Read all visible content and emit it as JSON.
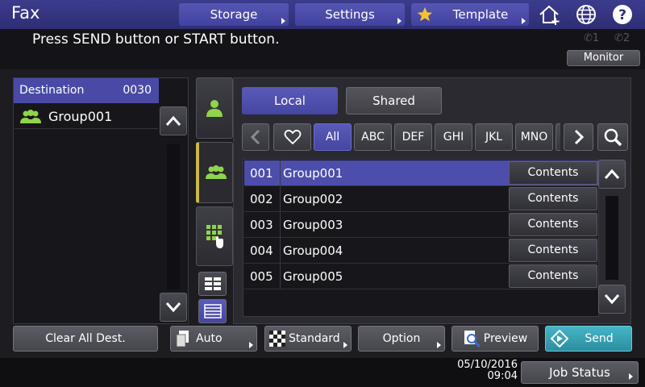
{
  "header": {
    "title": "Fax",
    "storage_label": "Storage",
    "settings_label": "Settings",
    "template_label": "Template",
    "icons": [
      "home-icon",
      "globe-icon",
      "help-icon"
    ]
  },
  "message": {
    "text": "Press SEND button or START button.",
    "line1": "1",
    "line2": "2",
    "monitor_label": "Monitor"
  },
  "destination": {
    "label": "Destination",
    "count": "0030",
    "items": [
      {
        "name": "Group001"
      }
    ]
  },
  "addressbook": {
    "local_label": "Local",
    "shared_label": "Shared",
    "index_tabs": [
      "All",
      "ABC",
      "DEF",
      "GHI",
      "JKL",
      "MNO"
    ],
    "selected_index": "All",
    "rows": [
      {
        "num": "001",
        "name": "Group001",
        "contents": "Contents",
        "selected": true
      },
      {
        "num": "002",
        "name": "Group002",
        "contents": "Contents",
        "selected": false
      },
      {
        "num": "003",
        "name": "Group003",
        "contents": "Contents",
        "selected": false
      },
      {
        "num": "004",
        "name": "Group004",
        "contents": "Contents",
        "selected": false
      },
      {
        "num": "005",
        "name": "Group005",
        "contents": "Contents",
        "selected": false
      }
    ]
  },
  "bottom": {
    "clear_label": "Clear All Dest.",
    "auto_label": "Auto",
    "standard_label": "Standard",
    "option_label": "Option",
    "preview_label": "Preview",
    "send_label": "Send"
  },
  "footer": {
    "date": "05/10/2016",
    "time": "09:04",
    "job_status_label": "Job Status"
  },
  "colors": {
    "accent": "#4d4dab",
    "send": "#3aa4b5",
    "icon_green": "#8fd44a"
  }
}
